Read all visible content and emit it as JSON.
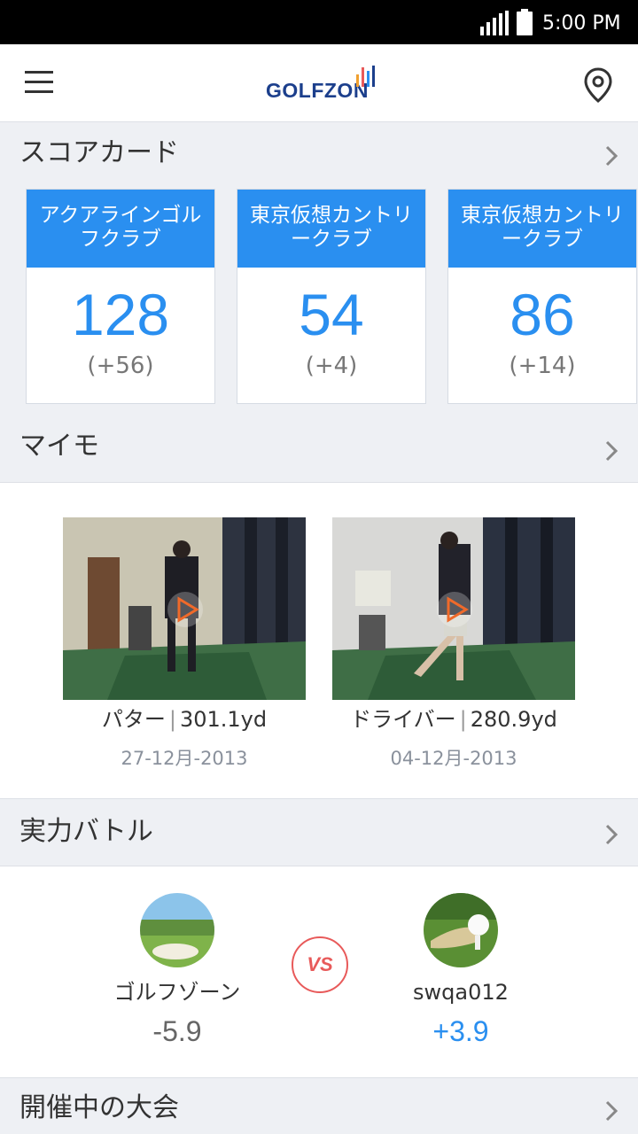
{
  "status_bar": {
    "time": "5:00 PM"
  },
  "app_bar": {
    "logo_text": "GOLFZON"
  },
  "scorecard": {
    "title": "スコアカード",
    "cards": [
      {
        "course": "アクアラインゴルフクラブ",
        "score": "128",
        "diff": "(+56)"
      },
      {
        "course": "東京仮想カントリークラブ",
        "score": "54",
        "diff": "(+4)"
      },
      {
        "course": "東京仮想カントリークラブ",
        "score": "86",
        "diff": "(+14)"
      }
    ]
  },
  "mymo": {
    "title": "マイモ",
    "videos": [
      {
        "club": "パター",
        "distance": "301.1yd",
        "date": "27-12月-2013"
      },
      {
        "club": "ドライバー",
        "distance": "280.9yd",
        "date": "04-12月-2013"
      }
    ]
  },
  "battle": {
    "title": "実力バトル",
    "vs_label": "VS",
    "players": [
      {
        "name": "ゴルフゾーン",
        "score": "-5.9",
        "color": "#666666"
      },
      {
        "name": "swqa012",
        "score": "+3.9",
        "color": "#2a8ff0"
      }
    ]
  },
  "tournament": {
    "title": "開催中の大会"
  },
  "colors": {
    "accent": "#2a8ff0",
    "background": "#eef0f4",
    "vs": "#e85a5a"
  },
  "icons": [
    "menu-icon",
    "location-pin-icon",
    "chevron-right-icon",
    "play-icon",
    "signal-icon",
    "battery-icon"
  ]
}
